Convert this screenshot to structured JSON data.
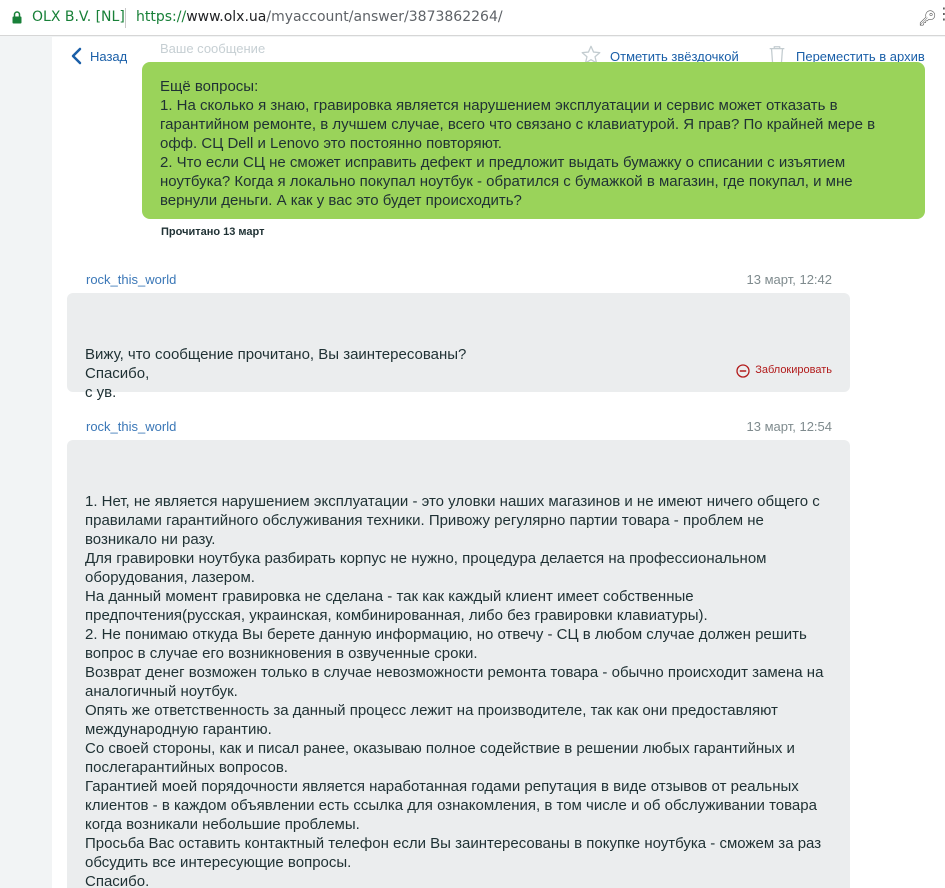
{
  "browser": {
    "site_identity": "OLX B.V. [NL]",
    "url_scheme": "https://",
    "url_host": "www.olx.ua",
    "url_path": "/myaccount/answer/3873862264/"
  },
  "toolbar": {
    "back_label": "Назад",
    "faded_title": "Ваше сообщение",
    "star_label": "Отметить звёздочкой",
    "archive_label": "Переместить в архив"
  },
  "own_message": {
    "text": "Ещё вопросы:\n1. На сколько я знаю, гравировка является нарушением эксплуатации и сервис может отказать в гарантийном ремонте, в лучшем случае, всего что связано с клавиатурой. Я прав? По крайней мере в офф. СЦ Dell и Lenovo это постоянно повторяют.\n2. Что если СЦ не сможет исправить дефект и предложит выдать бумажку о списании с изъятием ноутбука? Когда я локально покупал ноутбук - обратился с бумажкой в магазин, где покупал, и мне вернули деньги. А как у вас это будет происходить?",
    "read_status": "Прочитано 13 март"
  },
  "messages": [
    {
      "sender": "rock_this_world",
      "time": "13 март, 12:42",
      "text": "Вижу, что сообщение прочитано, Вы заинтересованы?\nСпасибо,\nс ув.",
      "block_label": "Заблокировать"
    },
    {
      "sender": "rock_this_world",
      "time": "13 март, 12:54",
      "text": "1. Нет, не является нарушением эксплуатации - это уловки наших магазинов и не имеют ничего общего с правилами гарантийного обслуживания техники. Привожу регулярно партии товара - проблем не возникало ни разу.\nДля гравировки ноутбука разбирать корпус не нужно, процедура делается на профессиональном оборудования, лазером.\nНа данный момент гравировка не сделана - так как каждый клиент имеет собственные предпочтения(русская, украинская, комбинированная, либо без гравировки клавиатуры).\n2. Не понимаю откуда Вы берете данную информацию, но отвечу - СЦ в любом случае должен решить вопрос в случае его возникновения в озвученные сроки.\nВозврат денег возможен только в случае невозможности ремонта товара - обычно происходит замена на аналогичный ноутбук.\nОпять же ответственность за данный процесс лежит на производителе, так как они предоставляют международную гарантию.\nСо своей стороны, как и писал ранее, оказываю полное содействие в решении любых гарантийных и послегарантийных вопросов.\nГарантией моей порядочности является наработанная годами репутация в виде отзывов от реальных клиентов - в каждом объявлении есть ссылка для ознакомления, в том числе и об обслуживании товара когда возникали небольшие проблемы.\nПросьба Вас оставить контактный телефон если Вы заинтересованы в покупке ноутбука - сможем за раз обсудить все интересующие вопросы.\nСпасибо.\nС ув.,\nДмитрий"
    }
  ],
  "colors": {
    "own_bubble": "#9ad35a",
    "other_bubble": "#ebedee",
    "link": "#1a5fa8",
    "block": "#b21b1b"
  }
}
